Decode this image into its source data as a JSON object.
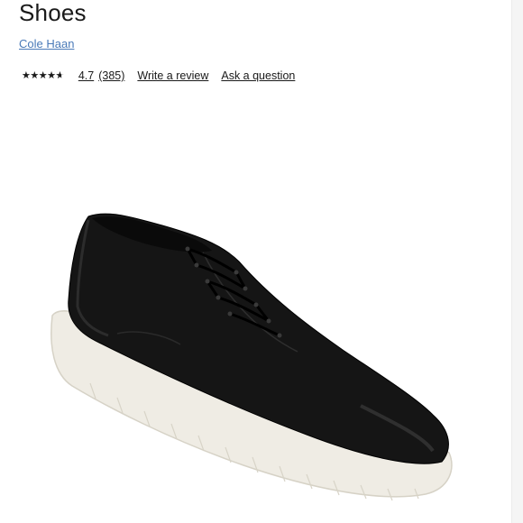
{
  "product": {
    "title": "Shoes",
    "brand": "Cole Haan"
  },
  "rating": {
    "value": 4.7,
    "value_label": "4.7",
    "max": 5,
    "stars_glyph": "★★★★★",
    "count_label": "(385)"
  },
  "actions": {
    "write_review": "Write a review",
    "ask_question": "Ask a question"
  },
  "image": {
    "subject": "black leather lace-up derby shoe with white sole",
    "colors": {
      "upper": "#141414",
      "sole": "#efece4"
    }
  }
}
